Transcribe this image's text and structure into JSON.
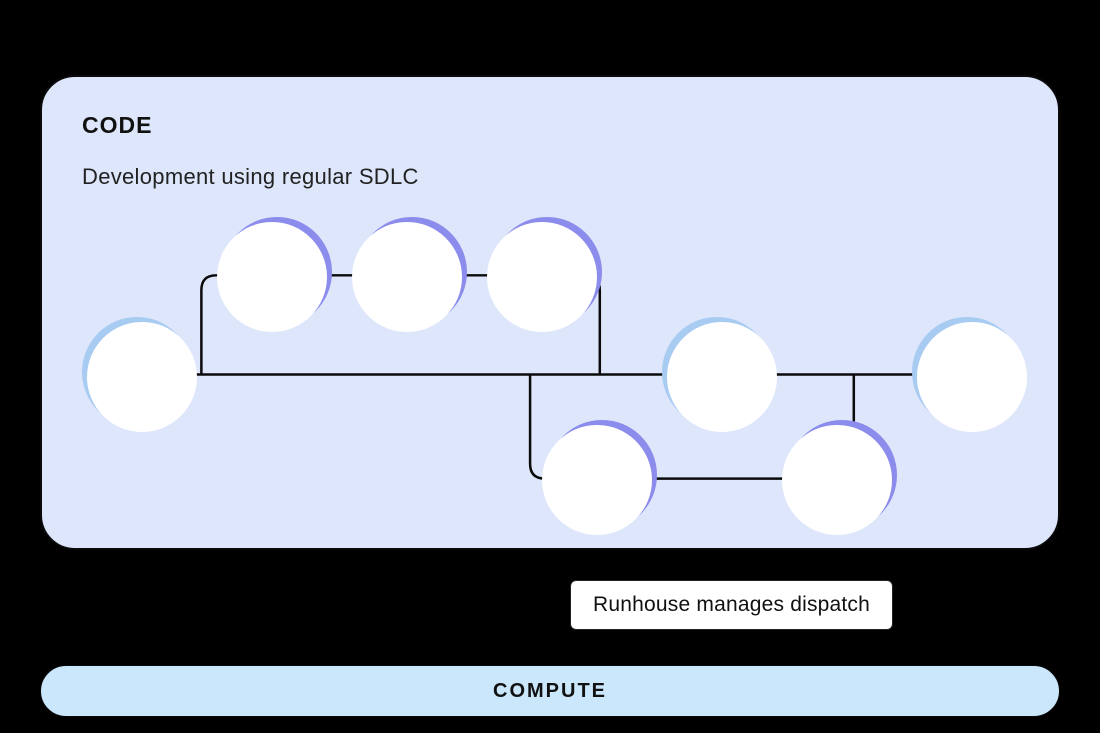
{
  "code_panel": {
    "title": "CODE",
    "subtitle": "Development using regular SDLC"
  },
  "dispatch": {
    "label": "Runhouse manages dispatch"
  },
  "compute": {
    "label": "COMPUTE"
  },
  "colors": {
    "background": "#000000",
    "code_panel_bg": "#DDE6FB",
    "compute_bg": "#CAE7FB",
    "node_fill": "#FFFFFF",
    "node_shadow_blue": "#A8CBF2",
    "node_shadow_purple": "#8B8CEB",
    "border": "#0a0a0a"
  },
  "diagram": {
    "type": "flow-graph",
    "nodes": [
      {
        "id": 1,
        "row": "mid",
        "accent": "blue"
      },
      {
        "id": 2,
        "row": "top",
        "accent": "purple"
      },
      {
        "id": 3,
        "row": "top",
        "accent": "purple"
      },
      {
        "id": 4,
        "row": "top",
        "accent": "purple"
      },
      {
        "id": 5,
        "row": "bot",
        "accent": "purple"
      },
      {
        "id": 6,
        "row": "mid",
        "accent": "blue"
      },
      {
        "id": 7,
        "row": "bot",
        "accent": "purple"
      },
      {
        "id": 8,
        "row": "mid",
        "accent": "blue"
      }
    ],
    "edges": [
      [
        1,
        2
      ],
      [
        2,
        3
      ],
      [
        3,
        4
      ],
      [
        1,
        8
      ],
      [
        4,
        5
      ],
      [
        5,
        7
      ],
      [
        4,
        6
      ],
      [
        6,
        7
      ],
      [
        7,
        8
      ]
    ]
  }
}
